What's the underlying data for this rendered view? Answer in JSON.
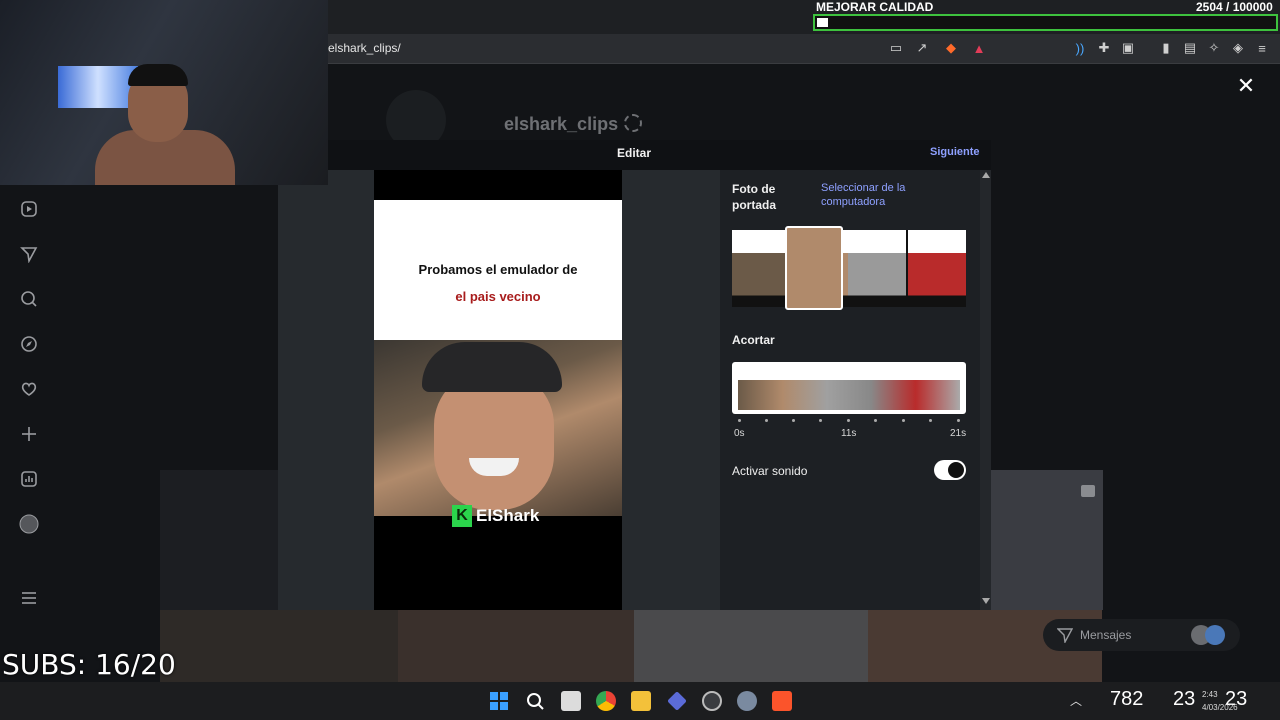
{
  "browser": {
    "url": "elshark_clips/"
  },
  "overlay": {
    "quality_label": "MEJORAR CALIDAD",
    "quality_count": "2504 / 100000",
    "quality_progress": 0.025,
    "subs": "SUBS: 16/20"
  },
  "profile": {
    "name": "elshark_clips"
  },
  "modal": {
    "title": "Editar",
    "next": "Siguiente",
    "preview": {
      "line1": "Probamos el emulador de",
      "line2": "el pais vecino",
      "brand": "ElShark"
    },
    "cover": {
      "label": "Foto de portada",
      "select_link": "Seleccionar de la computadora"
    },
    "trim": {
      "label": "Acortar",
      "start": "0s",
      "mid": "11s",
      "end": "21s"
    },
    "sound": {
      "label": "Activar sonido",
      "on": true
    }
  },
  "messages": {
    "label": "Mensajes"
  },
  "taskbar": {
    "tray_number": "782",
    "tray_a": "23",
    "tray_b": "23",
    "clock": "2:43",
    "date": "4/03/2026"
  },
  "colors": {
    "accent_link": "#8ea0ff",
    "progress_border": "#3ec23e",
    "brand_green": "#2bd44c"
  }
}
